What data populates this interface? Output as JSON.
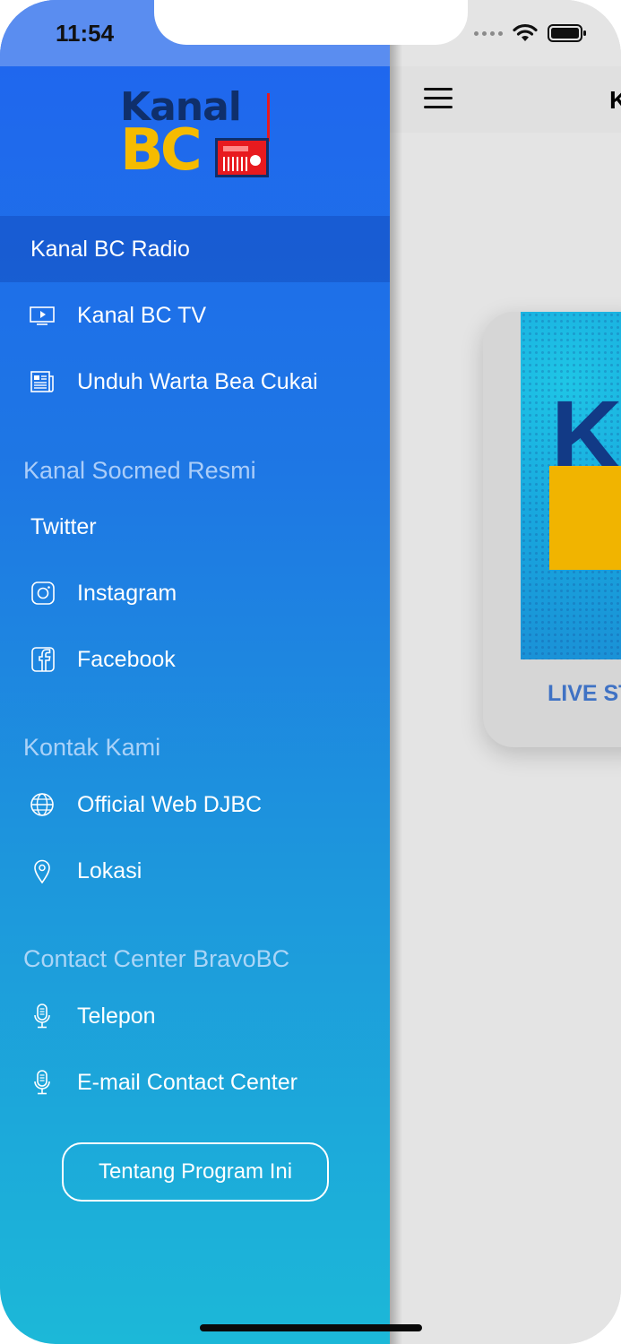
{
  "status_bar": {
    "time": "11:54"
  },
  "main": {
    "nav_title": "K",
    "card_logo_k": "K",
    "card_caption": "LIVE ST"
  },
  "drawer": {
    "logo": {
      "line1": "Kanal",
      "line2": "BC"
    },
    "items_top": [
      {
        "label": "Kanal BC Radio",
        "icon": "none",
        "selected": true
      },
      {
        "label": "Kanal BC TV",
        "icon": "tv-icon"
      },
      {
        "label": "Unduh Warta Bea Cukai",
        "icon": "newspaper-icon"
      }
    ],
    "section_socmed": "Kanal Socmed Resmi",
    "items_socmed": [
      {
        "label": "Twitter",
        "icon": "none"
      },
      {
        "label": "Instagram",
        "icon": "instagram-icon"
      },
      {
        "label": "Facebook",
        "icon": "facebook-icon"
      }
    ],
    "section_kontak": "Kontak Kami",
    "items_kontak": [
      {
        "label": "Official Web DJBC",
        "icon": "globe-icon"
      },
      {
        "label": "Lokasi",
        "icon": "location-pin-icon"
      }
    ],
    "section_contact_center": "Contact Center BravoBC",
    "items_contact_center": [
      {
        "label": "Telepon",
        "icon": "microphone-icon"
      },
      {
        "label": "E-mail Contact Center",
        "icon": "microphone-icon"
      }
    ],
    "about_button": "Tentang Program Ini"
  },
  "colors": {
    "drawer_top": "#1f67ee",
    "drawer_bottom": "#1cb8d8",
    "logo_yellow": "#f5bb00",
    "logo_navy": "#0f2f6b",
    "logo_red": "#e81a1f",
    "caption_blue": "#3f72c4"
  }
}
